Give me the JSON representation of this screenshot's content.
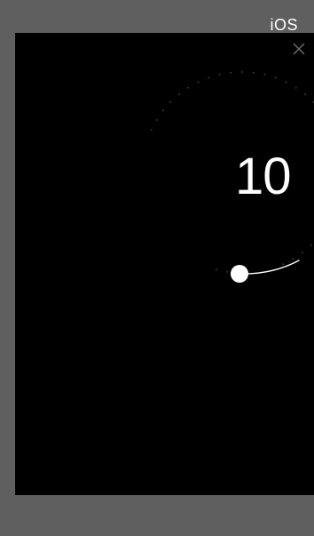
{
  "platform_label": "iOS",
  "timer": {
    "value": "10"
  },
  "colors": {
    "outer_background": "#5f5f5f",
    "screen_background": "#000000",
    "foreground": "#ffffff",
    "close_icon": "#6e6e6e",
    "dial_dots": "#3a3a3a"
  },
  "icons": {
    "close": "close-icon",
    "slider_handle": "dial-knob"
  }
}
